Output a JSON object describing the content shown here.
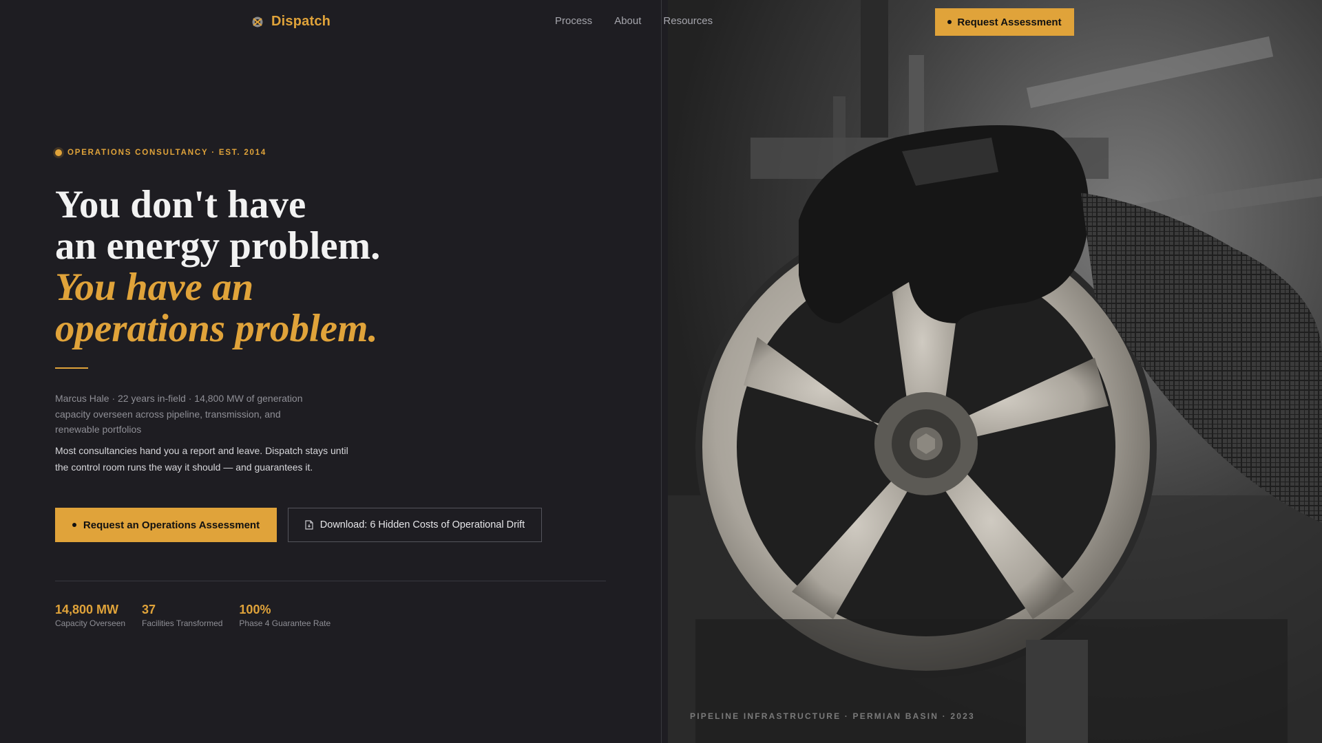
{
  "nav": {
    "brand": "Dispatch",
    "links": [
      "Process",
      "About",
      "Resources"
    ],
    "cta_label": "Request Assessment"
  },
  "hero": {
    "eyebrow": "OPERATIONS CONSULTANCY · EST. 2014",
    "headline": {
      "line1": "You don't have",
      "line2": "an energy problem.",
      "line3": "You have an",
      "line4": "operations problem."
    },
    "bio": "Marcus Hale · 22 years in-field · 14,800 MW of generation capacity overseen across pipeline, transmission, and renewable portfolios",
    "pitch": "Most consultancies hand you a report and leave. Dispatch stays until the control room runs the way it should — and guarantees it.",
    "primary_cta": "Request an Operations Assessment",
    "secondary_cta": "Download: 6 Hidden Costs of Operational Drift"
  },
  "stats": [
    {
      "value": "14,800 MW",
      "label": "Capacity Overseen"
    },
    {
      "value": "37",
      "label": "Facilities Transformed"
    },
    {
      "value": "100%",
      "label": "Phase 4 Guarantee Rate"
    }
  ],
  "photo": {
    "caption": "PIPELINE INFRASTRUCTURE · PERMIAN BASIN · 2023"
  },
  "colors": {
    "accent": "#e0a33a",
    "background": "#1e1d22",
    "text": "#f2f2f2",
    "muted": "#8f8f96"
  },
  "icons": {
    "logo": "logo-mark-icon",
    "cta_dot": "dot-icon",
    "download": "document-icon"
  }
}
